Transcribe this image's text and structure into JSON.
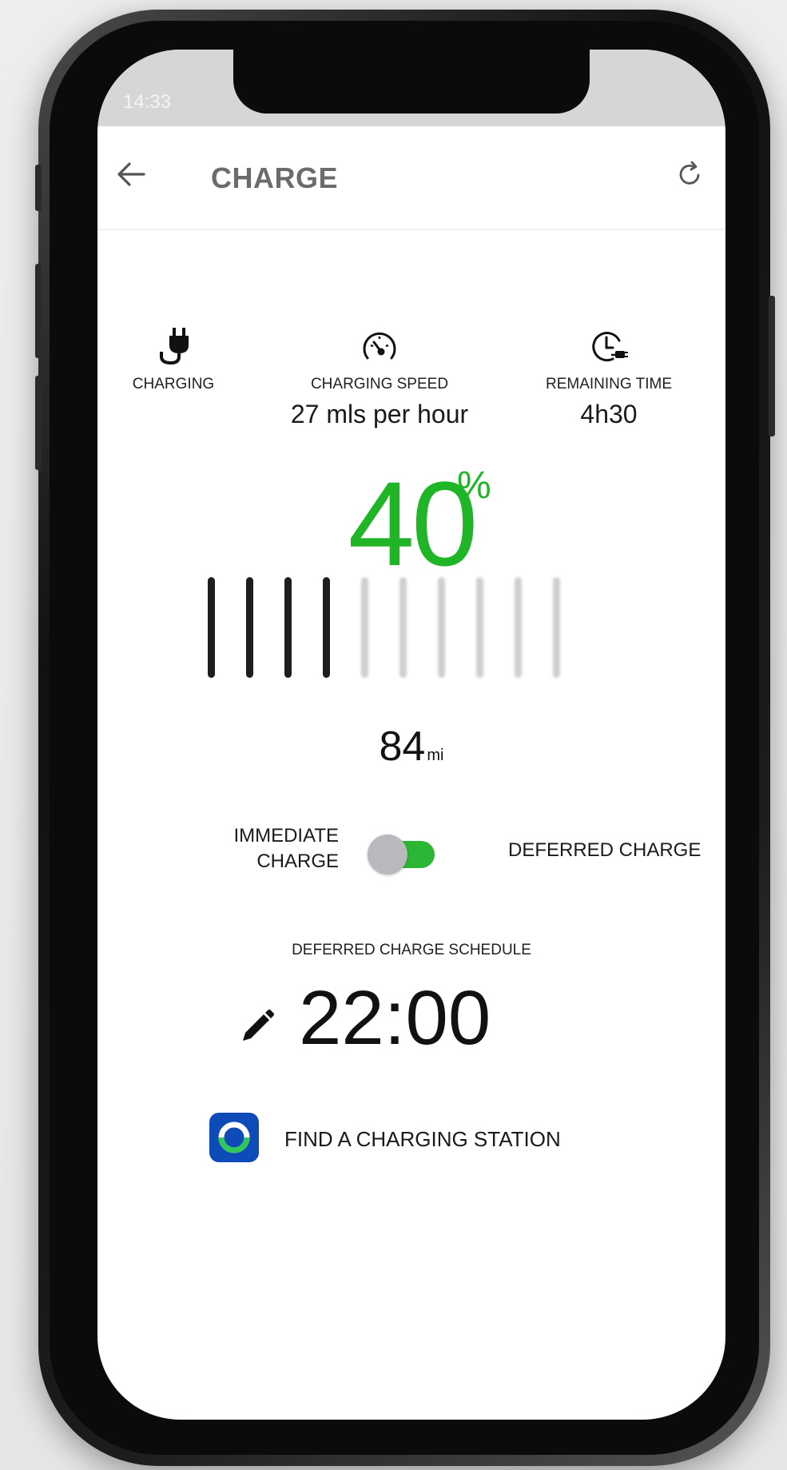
{
  "status_bar": {
    "time": "14:33"
  },
  "header": {
    "title": "CHARGE"
  },
  "stats": [
    {
      "icon": "plug-icon",
      "label": "CHARGING",
      "value": ""
    },
    {
      "icon": "speedometer-icon",
      "label": "CHARGING SPEED",
      "value": "27 mls per hour"
    },
    {
      "icon": "clock-plug-icon",
      "label": "REMAINING TIME",
      "value": "4h30"
    }
  ],
  "battery": {
    "percent": "40",
    "percent_sign": "%",
    "level_fraction": 0.4,
    "bar_count": 10,
    "bars_filled": 4,
    "accent_color": "#1fb526"
  },
  "range": {
    "value": "84",
    "unit": "mi"
  },
  "charge_mode": {
    "left_label_line1": "IMMEDIATE",
    "left_label_line2": "CHARGE",
    "right_label": "DEFERRED CHARGE",
    "selected": "DEFERRED CHARGE",
    "toggle_color": "#2bb735"
  },
  "schedule": {
    "label": "DEFERRED CHARGE SCHEDULE",
    "time": "22:00"
  },
  "station": {
    "label": "FIND A CHARGING STATION"
  }
}
